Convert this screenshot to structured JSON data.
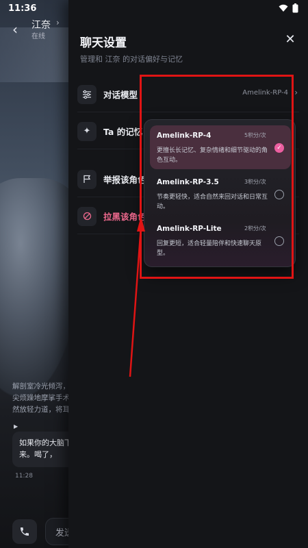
{
  "status": {
    "time": "11:36"
  },
  "chat": {
    "name": "江奈",
    "status": "在线",
    "narration": "解剖室冷光倾泻，尖烦躁地摩挲手术然放轻力道，将耳",
    "bubble": "如果你的大脑下来。喝了，",
    "time": "11:28",
    "input_placeholder": "发送"
  },
  "panel": {
    "title": "聊天设置",
    "subtitle": "管理和 江奈 的对话偏好与记忆",
    "rows": [
      {
        "label": "对话模型",
        "value": "Amelink-RP-4"
      },
      {
        "label": "Ta 的记忆"
      },
      {
        "label": "举报该角色"
      },
      {
        "label": "拉黑该角色"
      }
    ]
  },
  "models": [
    {
      "name": "Amelink-RP-4",
      "cost": "5积分/次",
      "desc": "更擅长长记忆、复杂情绪和细节驱动的角色互动。",
      "selected": true
    },
    {
      "name": "Amelink-RP-3.5",
      "cost": "3积分/次",
      "desc": "节奏更轻快，适合自然来回对话和日常互动。",
      "selected": false
    },
    {
      "name": "Amelink-RP-Lite",
      "cost": "2积分/次",
      "desc": "回复更短，适合轻量陪伴和快速聊天原型。",
      "selected": false
    }
  ],
  "colors": {
    "accent": "#ec5fa0",
    "danger": "#f06a8f",
    "annotation": "#e01414"
  }
}
